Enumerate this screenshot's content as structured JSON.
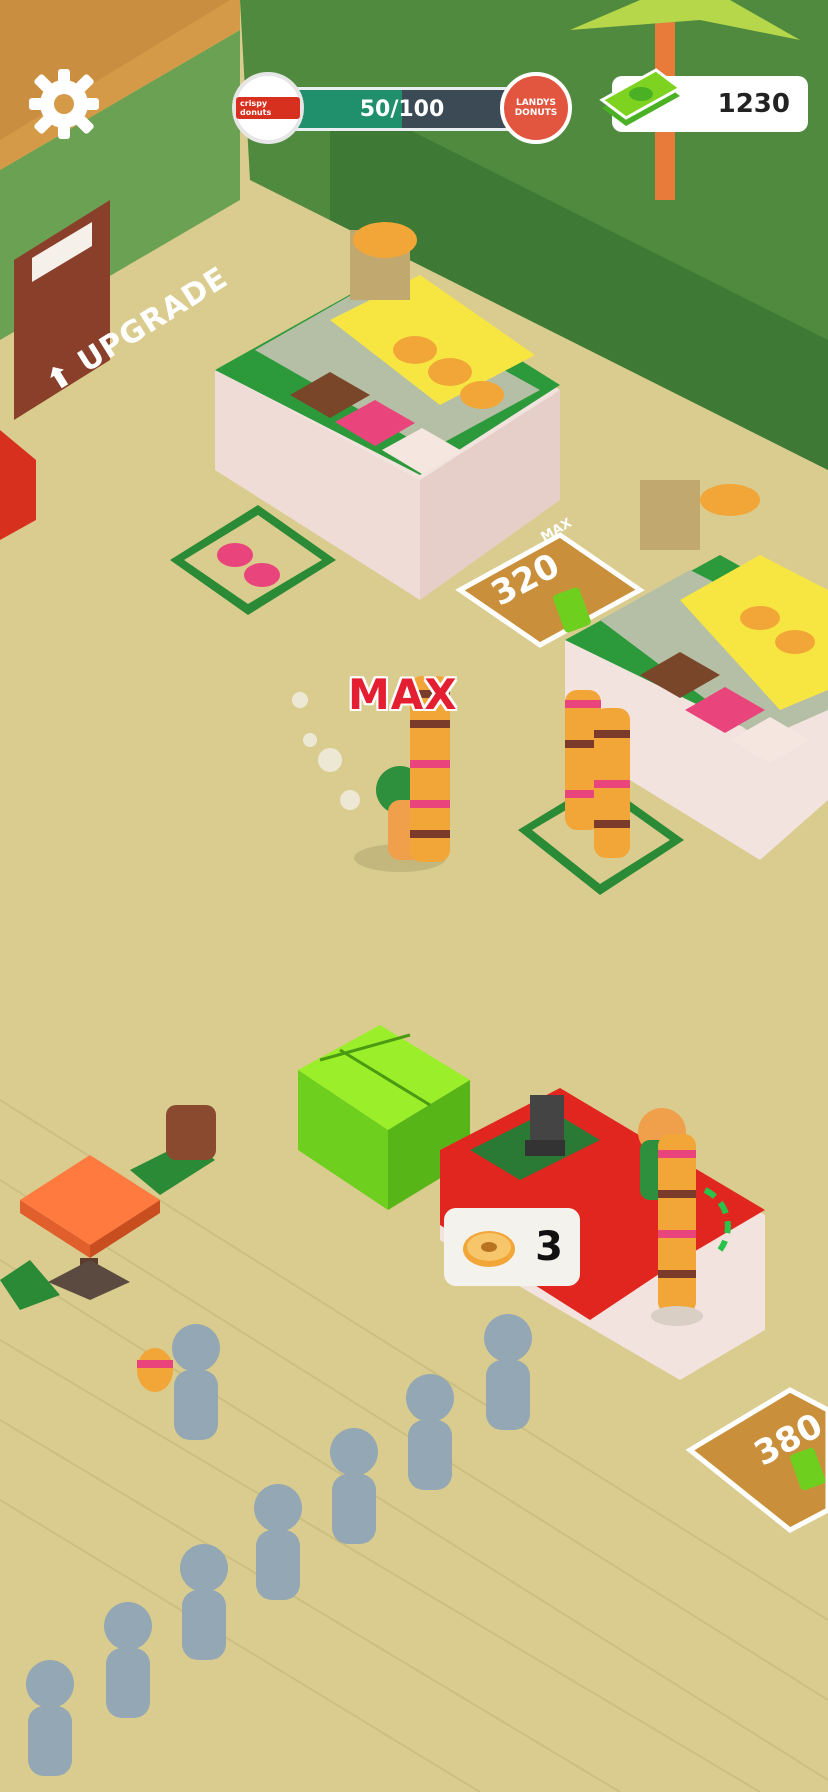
{
  "hud": {
    "progress": {
      "text": "50/100",
      "value": 50,
      "max": 100
    },
    "brand_left": "crispy donuts",
    "brand_right": "LANDYS DONUTS",
    "money": "1230",
    "settings_icon": "gear-icon",
    "money_icon": "cash-stack-icon"
  },
  "labels": {
    "upgrade": "UPGRADE",
    "max_carry": "MAX",
    "max_station": "MAX"
  },
  "prices": {
    "station_upgrade": "320",
    "counter_upgrade": "380"
  },
  "order": {
    "icon": "donut-icon",
    "count": "3"
  },
  "colors": {
    "floor": "#d9cc8e",
    "wall": "#5e9a4a",
    "accent_red": "#e41f32",
    "cash_green": "#7ed321",
    "progress_fill": "#1f8f6c"
  }
}
